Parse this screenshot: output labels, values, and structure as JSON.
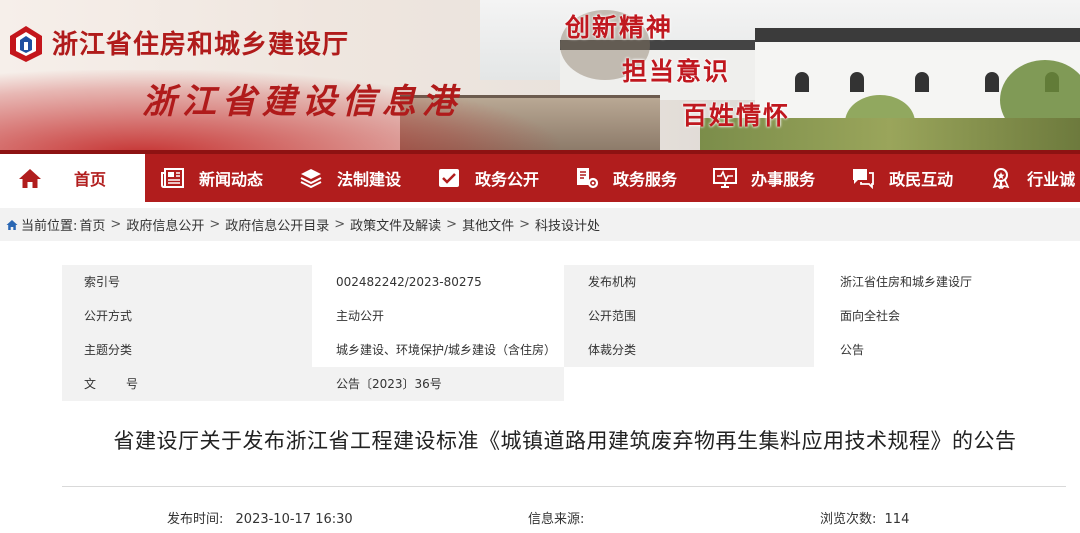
{
  "header": {
    "site_title": "浙江省住房和城乡建设厅",
    "site_subtitle": "浙江省建设信息港",
    "slogans": [
      "创新精神",
      "担当意识",
      "百姓情怀"
    ],
    "brand_color": "#b11d1d"
  },
  "nav": {
    "items": [
      {
        "label": "首页",
        "icon": "home-icon",
        "active": true
      },
      {
        "label": "新闻动态",
        "icon": "newspaper-icon"
      },
      {
        "label": "法制建设",
        "icon": "layers-icon"
      },
      {
        "label": "政务公开",
        "icon": "checklist-icon"
      },
      {
        "label": "政务服务",
        "icon": "document-gear-icon"
      },
      {
        "label": "办事服务",
        "icon": "monitor-icon"
      },
      {
        "label": "政民互动",
        "icon": "chat-icon"
      },
      {
        "label": "行业诚",
        "icon": "badge-icon"
      }
    ]
  },
  "breadcrumb": {
    "prefix": "当前位置:",
    "items": [
      "首页",
      "政府信息公开",
      "政府信息公开目录",
      "政策文件及解读",
      "其他文件",
      "科技设计处"
    ],
    "separator": ">"
  },
  "meta": {
    "rows": [
      {
        "k1": "索引号",
        "v1": "002482242/2023-80275",
        "k2": "发布机构",
        "v2": "浙江省住房和城乡建设厅"
      },
      {
        "k1": "公开方式",
        "v1": "主动公开",
        "k2": "公开范围",
        "v2": "面向全社会"
      },
      {
        "k1": "主题分类",
        "v1": "城乡建设、环境保护/城乡建设（含住房）",
        "k2": "体裁分类",
        "v2": "公告"
      },
      {
        "k1": "文　　号",
        "v1": "公告〔2023〕36号",
        "k2": "",
        "v2": ""
      }
    ]
  },
  "article": {
    "title": "省建设厅关于发布浙江省工程建设标准《城镇道路用建筑废弃物再生集料应用技术规程》的公告",
    "publish_label": "发布时间:",
    "publish_time": "2023-10-17 16:30",
    "source_label": "信息来源:",
    "source_value": "",
    "views_label": "浏览次数:",
    "views_value": "114"
  }
}
